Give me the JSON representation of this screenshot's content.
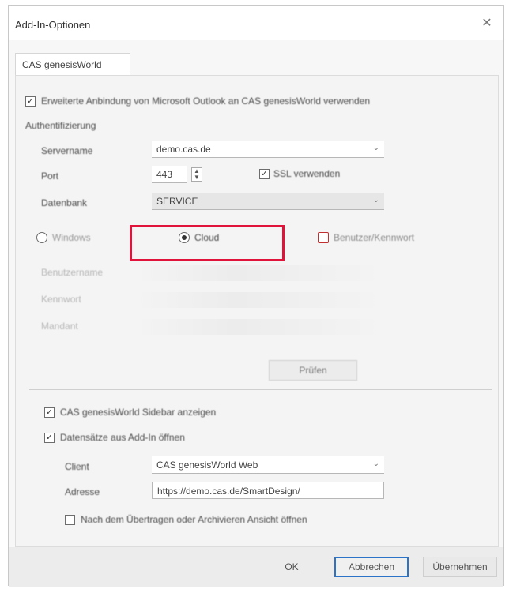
{
  "window": {
    "title": "Add-In-Optionen",
    "close_glyph": "✕"
  },
  "tabs": [
    {
      "label": "CAS genesisWorld"
    }
  ],
  "options": {
    "extended_connection_label": "Erweiterte Anbindung von Microsoft Outlook an CAS genesisWorld verwenden",
    "auth_section_label": "Authentifizierung",
    "server_label": "Servername",
    "server_value": "demo.cas.de",
    "port_label": "Port",
    "port_value": "443",
    "ssl_label": "SSL verwenden",
    "ssl_checked": true,
    "database_label": "Datenbank",
    "database_value": "SERVICE",
    "auth_modes": [
      {
        "label": "Windows",
        "checked": false
      },
      {
        "label": "Cloud",
        "checked": true
      },
      {
        "label": "Benutzer/Kennwort",
        "checked": false
      }
    ],
    "faded_label_1": "Benutzername",
    "faded_label_2": "Kennwort",
    "faded_label_3": "Mandant",
    "check_button_label": "Prüfen",
    "sidebar_label": "CAS genesisWorld Sidebar anzeigen",
    "sidebar_checked": true,
    "open_records_label": "Datensätze aus Add-In öffnen",
    "open_records_checked": true,
    "client_label": "Client",
    "client_value": "CAS genesisWorld Web",
    "address_label": "Adresse",
    "address_value": "https://demo.cas.de/SmartDesign/",
    "after_transfer_label": "Nach dem Übertragen oder Archivieren Ansicht öffnen",
    "after_transfer_checked": false
  },
  "footer": {
    "ok_label": "OK",
    "cancel_label": "Abbrechen",
    "apply_label": "Übernehmen"
  },
  "colors": {
    "highlight": "#e0143a",
    "primary_border": "#2b73c9"
  }
}
